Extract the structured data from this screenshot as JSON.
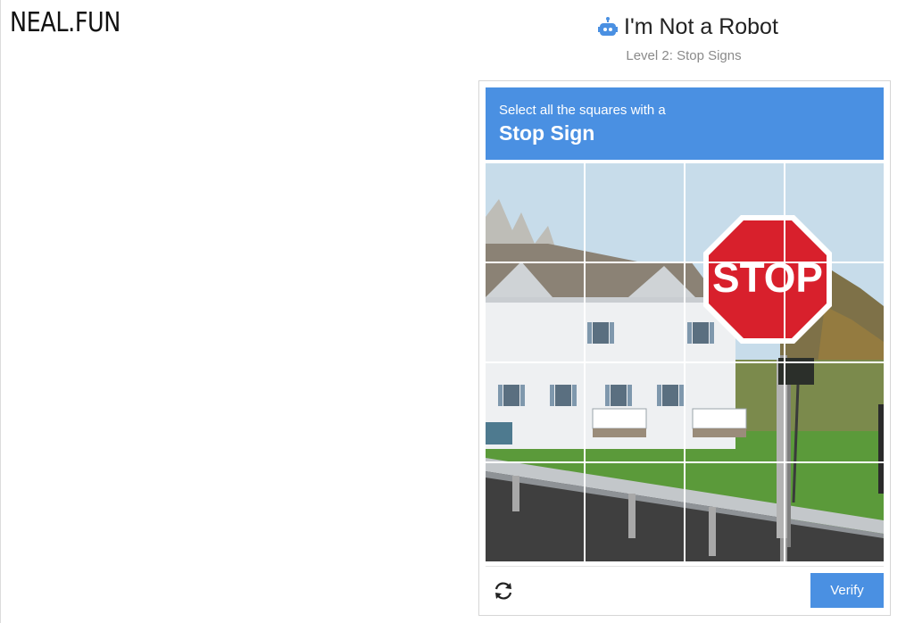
{
  "header": {
    "logo": "NEAL.FUN",
    "title": "I'm Not a Robot",
    "subtitle": "Level 2: Stop Signs",
    "title_icon": "robot-icon"
  },
  "captcha": {
    "instruction": "Select all the squares with a",
    "target": "Stop Sign",
    "sign_text": "STOP",
    "grid": {
      "rows": 4,
      "cols": 4,
      "tiles": [
        {
          "row": 1,
          "col": 1
        },
        {
          "row": 1,
          "col": 2
        },
        {
          "row": 1,
          "col": 3
        },
        {
          "row": 1,
          "col": 4
        },
        {
          "row": 2,
          "col": 1
        },
        {
          "row": 2,
          "col": 2
        },
        {
          "row": 2,
          "col": 3
        },
        {
          "row": 2,
          "col": 4
        },
        {
          "row": 3,
          "col": 1
        },
        {
          "row": 3,
          "col": 2
        },
        {
          "row": 3,
          "col": 3
        },
        {
          "row": 3,
          "col": 4
        },
        {
          "row": 4,
          "col": 1
        },
        {
          "row": 4,
          "col": 2
        },
        {
          "row": 4,
          "col": 3
        },
        {
          "row": 4,
          "col": 4
        }
      ]
    },
    "reload_icon": "reload-icon",
    "verify_label": "Verify"
  },
  "colors": {
    "accent": "#4a90e2",
    "stop_red": "#d8202c",
    "sky": "#c7dcea",
    "grass": "#5b9a3a",
    "house": "#eef0f2",
    "roof": "#8b8275"
  }
}
